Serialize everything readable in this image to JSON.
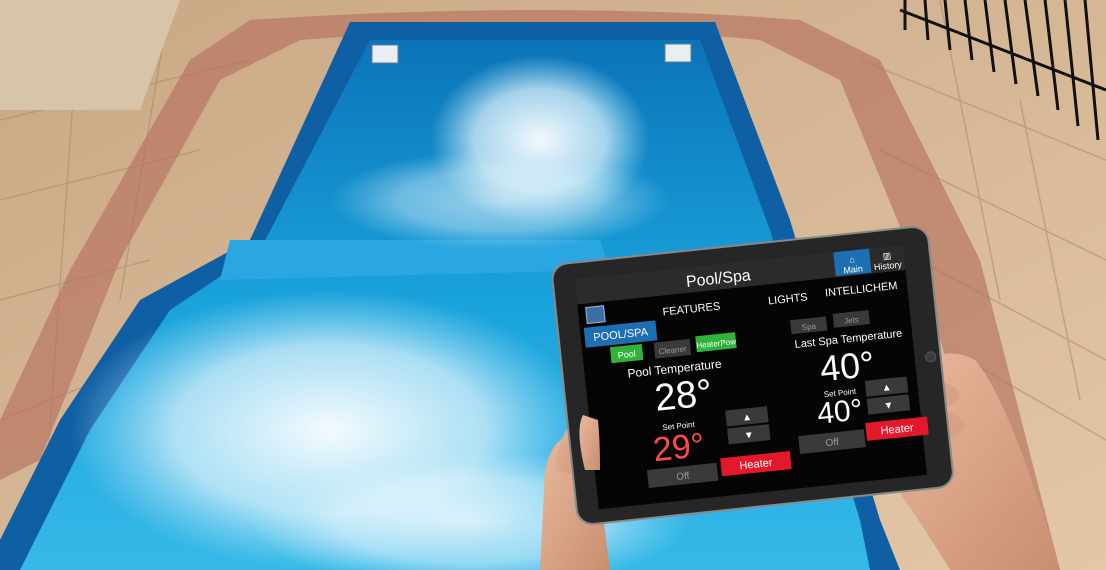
{
  "app": {
    "title": "Pool/Spa"
  },
  "top_nav": {
    "main_label": "Main",
    "history_label": "History",
    "main_icon": "home-icon",
    "history_icon": "chart-icon"
  },
  "logo": {
    "icon": "pentair-logo-icon"
  },
  "tabs": [
    {
      "label": "POOL/SPA",
      "active": true
    },
    {
      "label": "FEATURES",
      "active": false
    },
    {
      "label": "LIGHTS",
      "active": false
    },
    {
      "label": "INTELLICHEM",
      "active": false
    }
  ],
  "pool": {
    "feature_buttons": [
      {
        "label": "Pool",
        "active": true
      },
      {
        "label": "Cleaner",
        "active": false
      },
      {
        "label": "HeaterPow",
        "active": true
      }
    ],
    "temp_label": "Pool Temperature",
    "temperature": "28°",
    "setpoint_label": "Set Point",
    "setpoint": "29°",
    "off_label": "Off",
    "heater_label": "Heater"
  },
  "spa": {
    "feature_buttons": [
      {
        "label": "Spa",
        "active": false
      },
      {
        "label": "Jets",
        "active": false
      }
    ],
    "temp_label": "Last Spa Temperature",
    "temperature": "40°",
    "setpoint_label": "Set Point",
    "setpoint": "40°",
    "off_label": "Off",
    "heater_label": "Heater"
  },
  "colors": {
    "water": "#1f9fd8",
    "deck": "#d9b996",
    "bezel": "#2a2a2a",
    "screen_bg": "#050505",
    "active_tab": "#1d6fb3",
    "green_button": "#31b23a",
    "red_button": "#e3192b",
    "setpoint_red": "#ff4a4a"
  }
}
